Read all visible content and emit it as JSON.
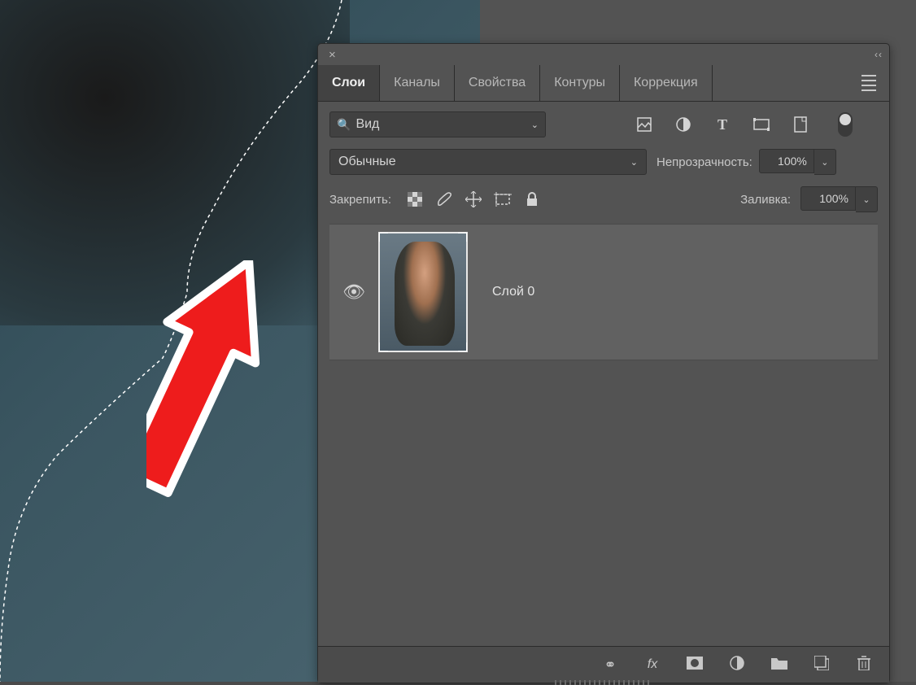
{
  "tabs": {
    "layers": "Слои",
    "channels": "Каналы",
    "properties": "Свойства",
    "paths": "Контуры",
    "adjustments": "Коррекция"
  },
  "search": {
    "label": "Вид"
  },
  "blend": {
    "mode": "Обычные",
    "opacity_label": "Непрозрачность:",
    "opacity_value": "100%",
    "fill_label": "Заливка:",
    "fill_value": "100%"
  },
  "lock": {
    "label": "Закрепить:"
  },
  "layer0": {
    "name": "Слой 0"
  },
  "bottombar": {
    "fx": "fx"
  }
}
